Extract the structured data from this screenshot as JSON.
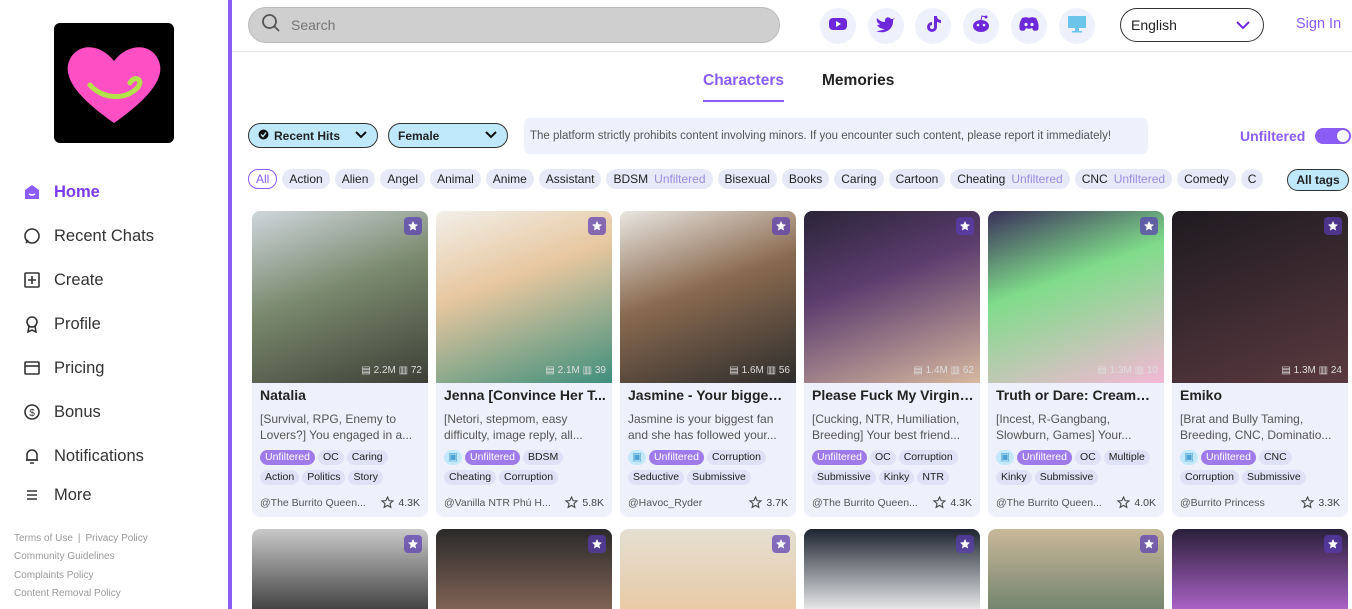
{
  "sidebar": {
    "items": [
      {
        "label": "Home",
        "icon": "home-icon",
        "active": true
      },
      {
        "label": "Recent Chats",
        "icon": "chat-bubble-icon"
      },
      {
        "label": "Create",
        "icon": "plus-square-icon"
      },
      {
        "label": "Profile",
        "icon": "award-icon"
      },
      {
        "label": "Pricing",
        "icon": "card-icon"
      },
      {
        "label": "Bonus",
        "icon": "dollar-icon"
      },
      {
        "label": "Notifications",
        "icon": "bell-icon"
      },
      {
        "label": "More",
        "icon": "menu-icon"
      }
    ],
    "footer": {
      "terms": "Terms of Use",
      "privacy": "Privacy Policy",
      "guidelines": "Community Guidelines",
      "complaints": "Complaints Policy",
      "removal": "Content Removal Policy"
    }
  },
  "header": {
    "search_placeholder": "Search",
    "socials": [
      "youtube-icon",
      "twitter-icon",
      "tiktok-icon",
      "reddit-icon",
      "discord-icon",
      "desktop-icon"
    ],
    "language": "English",
    "sign_in": "Sign In"
  },
  "tabs": [
    "Characters",
    "Memories"
  ],
  "filters": {
    "sort": "Recent Hits",
    "gender": "Female",
    "notice": "The platform strictly prohibits content involving minors. If you encounter such content, please report it immediately!",
    "unfiltered_label": "Unfiltered",
    "unfiltered_on": true
  },
  "tags": [
    {
      "label": "All"
    },
    {
      "label": "Action"
    },
    {
      "label": "Alien"
    },
    {
      "label": "Angel"
    },
    {
      "label": "Animal"
    },
    {
      "label": "Anime"
    },
    {
      "label": "Assistant"
    },
    {
      "label": "BDSM",
      "unf": "Unfiltered"
    },
    {
      "label": "Bisexual"
    },
    {
      "label": "Books"
    },
    {
      "label": "Caring"
    },
    {
      "label": "Cartoon"
    },
    {
      "label": "Cheating",
      "unf": "Unfiltered"
    },
    {
      "label": "CNC",
      "unf": "Unfiltered"
    },
    {
      "label": "Comedy"
    },
    {
      "label": "C"
    }
  ],
  "all_tags": "All tags",
  "cards": [
    {
      "name": "Natalia",
      "desc": "[Survival, RPG, Enemy to Lovers?] You engaged in a...",
      "views": "2.2M",
      "msgs": "72",
      "author": "@The Burrito Queen...",
      "likes": "4.3K",
      "tags": [
        "Unfiltered",
        "OC",
        "Caring",
        "Action",
        "Politics",
        "Story"
      ],
      "img_tag": false
    },
    {
      "name": "Jenna [Convince Her T...",
      "desc": "[Netori, stepmom, easy difficulty, image reply, all...",
      "views": "2.1M",
      "msgs": "39",
      "author": "@Vanilla NTR Phú H...",
      "likes": "5.8K",
      "tags": [
        "Unfiltered",
        "BDSM",
        "Cheating",
        "Corruption"
      ],
      "img_tag": true
    },
    {
      "name": "Jasmine - Your biggest...",
      "desc": "Jasmine is your biggest fan and she has followed your...",
      "views": "1.6M",
      "msgs": "56",
      "author": "@Havoc_Ryder",
      "likes": "3.7K",
      "tags": [
        "Unfiltered",
        "Corruption",
        "Seductive",
        "Submissive"
      ],
      "img_tag": true
    },
    {
      "name": "Please Fuck My Virgin ...",
      "desc": "[Cucking, NTR, Humiliation, Breeding] Your best friend...",
      "views": "1.4M",
      "msgs": "62",
      "author": "@The Burrito Queen...",
      "likes": "4.3K",
      "tags": [
        "Unfiltered",
        "OC",
        "Corruption",
        "Submissive",
        "Kinky",
        "NTR"
      ],
      "img_tag": false
    },
    {
      "name": "Truth or Dare: Creampi...",
      "desc": "[Incest, R-Gangbang, Slowburn, Games] Your...",
      "views": "1.3M",
      "msgs": "10",
      "author": "@The Burrito Queen...",
      "likes": "4.0K",
      "tags": [
        "Unfiltered",
        "OC",
        "Multiple",
        "Kinky",
        "Submissive"
      ],
      "img_tag": true
    },
    {
      "name": "Emiko",
      "desc": "[Brat and Bully Taming, Breeding, CNC, Dominatio...",
      "views": "1.3M",
      "msgs": "24",
      "author": "@Burrito Princess",
      "likes": "3.3K",
      "tags": [
        "Unfiltered",
        "CNC",
        "Corruption",
        "Submissive"
      ],
      "img_tag": true
    }
  ],
  "colors": {
    "accent": "#8b5cf6",
    "chip_blue": "#bfe9fb",
    "card_bg": "#eef0fb"
  }
}
